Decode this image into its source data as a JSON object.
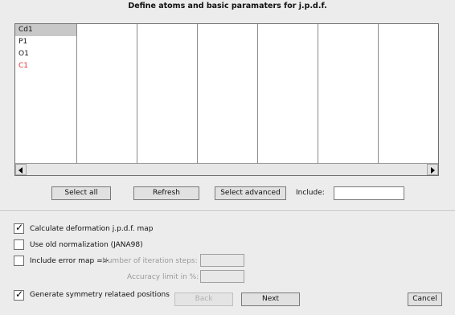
{
  "dialog": {
    "title": "Define atoms and basic paramaters for j.p.d.f."
  },
  "atoms": [
    {
      "name": "Cd1",
      "color": "#111111",
      "selected": true
    },
    {
      "name": "P1",
      "color": "#111111",
      "selected": false
    },
    {
      "name": "O1",
      "color": "#111111",
      "selected": false
    },
    {
      "name": "C1",
      "color": "#e03030",
      "selected": false
    }
  ],
  "buttons": {
    "select_all": "Select all",
    "refresh": "Refresh",
    "select_advanced": "Select advanced",
    "back": "Back",
    "next": "Next",
    "cancel": "Cancel"
  },
  "include": {
    "label": "Include:",
    "value": ""
  },
  "options": {
    "calc_deformation": {
      "label": "Calculate deformation j.p.d.f. map",
      "checked": true
    },
    "old_normalization": {
      "label": "Use old normalization (JANA98)",
      "checked": false
    },
    "include_error_map": {
      "label": "Include error map  =>",
      "checked": false
    },
    "generate_symmetry": {
      "label": "Generate symmetry relataed positions",
      "checked": true
    }
  },
  "error_map": {
    "iterations_label": "Number of iteration steps:",
    "iterations_value": "",
    "accuracy_label": "Accuracy limit in %:",
    "accuracy_value": ""
  },
  "icons": {
    "scroll_left": "arrow-left-icon",
    "scroll_right": "arrow-right-icon",
    "check": "checkmark-icon"
  }
}
